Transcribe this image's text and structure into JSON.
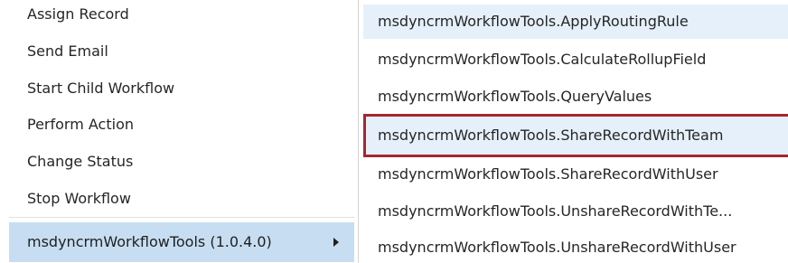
{
  "left_menu": {
    "items": [
      {
        "label": "Assign Record"
      },
      {
        "label": "Send Email"
      },
      {
        "label": "Start Child Workflow"
      },
      {
        "label": "Perform Action"
      },
      {
        "label": "Change Status"
      },
      {
        "label": "Stop Workflow"
      }
    ],
    "selected": {
      "label": "msdyncrmWorkflowTools (1.0.4.0)",
      "icon": "submenu-arrow-icon"
    }
  },
  "submenu": {
    "items": [
      {
        "label": "msdyncrmWorkflowTools.ApplyRoutingRule"
      },
      {
        "label": "msdyncrmWorkflowTools.CalculateRollupField"
      },
      {
        "label": "msdyncrmWorkflowTools.QueryValues"
      },
      {
        "label": "msdyncrmWorkflowTools.ShareRecordWithTeam"
      },
      {
        "label": "msdyncrmWorkflowTools.ShareRecordWithUser"
      },
      {
        "label": "msdyncrmWorkflowTools.UnshareRecordWithTe..."
      },
      {
        "label": "msdyncrmWorkflowTools.UnshareRecordWithUser"
      }
    ]
  },
  "colors": {
    "selected_bg": "#c7def2",
    "hover_bg": "#e5f0fa",
    "highlight_border": "#a52630"
  }
}
